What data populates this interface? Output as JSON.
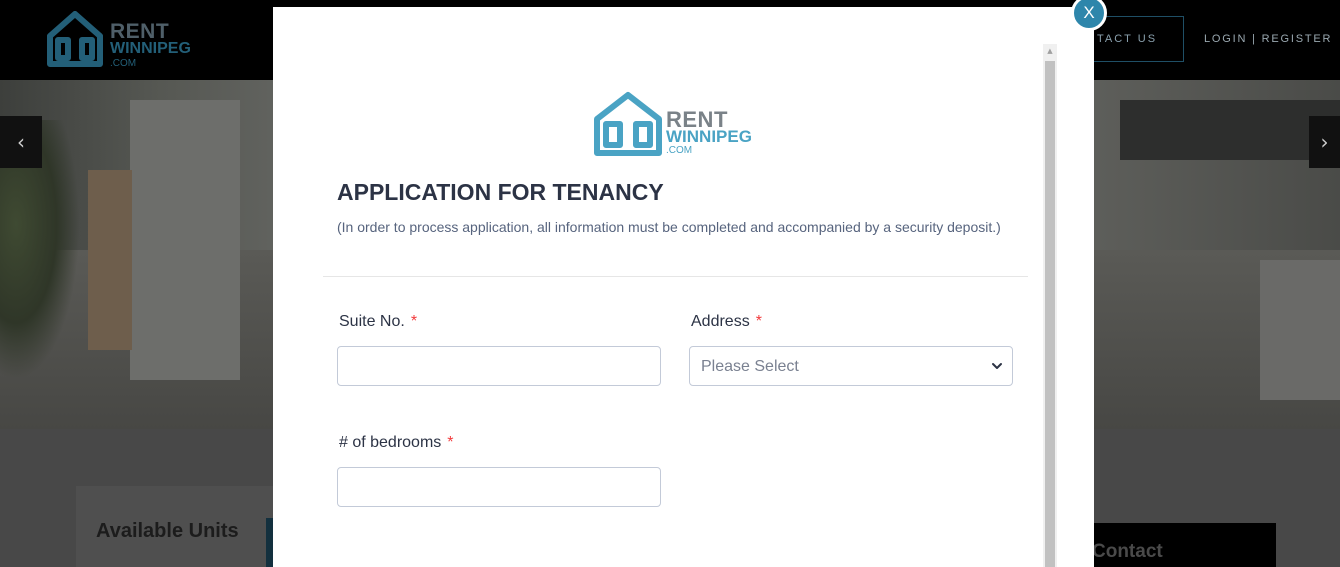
{
  "site": {
    "logo": {
      "line1": "RENT",
      "line2": "WINNIPEG",
      "line3": ".COM"
    },
    "nav": {
      "contact": "TACT US",
      "login": "LOGIN",
      "separator": "|",
      "register": "REGISTER"
    },
    "slider": {
      "prev_icon": "‹",
      "next_icon": "›"
    },
    "sections": {
      "available_units": "Available Units",
      "contact": "Contact"
    }
  },
  "modal": {
    "close_label": "X",
    "logo": {
      "line1": "RENT",
      "line2": "WINNIPEG",
      "line3": ".COM"
    },
    "title": "APPLICATION FOR TENANCY",
    "subtitle": "(In order to process application, all information must be completed and accompanied by a security deposit.)",
    "fields": {
      "suite": {
        "label": "Suite No.",
        "required_mark": "*",
        "value": ""
      },
      "address": {
        "label": "Address",
        "required_mark": "*",
        "selected": "Please Select"
      },
      "bedrooms": {
        "label": "# of bedrooms",
        "required_mark": "*",
        "value": ""
      }
    }
  },
  "colors": {
    "accent": "#2e86ab",
    "required": "#f23a3c",
    "title": "#2c3345",
    "logo_blue": "#4aa3c4"
  }
}
